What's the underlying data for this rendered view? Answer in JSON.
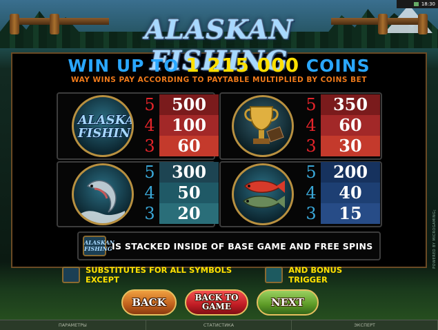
{
  "topbar": {
    "time": "18:30"
  },
  "logo": {
    "text": "ALASKAN FISHING"
  },
  "headline": {
    "prefix": "WIN UP TO",
    "amount": "1 215 000",
    "suffix": "COINS"
  },
  "subline": "WAY WINS PAY ACCORDING TO PAYTABLE MULTIPLIED BY COINS BET",
  "paytable": [
    {
      "symbol": "alaskan-fishing-logo",
      "symbol_text": "ALASKAN FISHING",
      "counts": [
        "5",
        "4",
        "3"
      ],
      "pays": [
        "500",
        "100",
        "60"
      ],
      "count_color": "#e4242a"
    },
    {
      "symbol": "trophy-cup-logbook",
      "counts": [
        "5",
        "4",
        "3"
      ],
      "pays": [
        "350",
        "60",
        "30"
      ],
      "count_color": "#e4242a"
    },
    {
      "symbol": "jumping-salmon",
      "counts": [
        "5",
        "4",
        "3"
      ],
      "pays": [
        "300",
        "50",
        "20"
      ],
      "count_color": "#3aa8d8"
    },
    {
      "symbol": "fish-pair",
      "counts": [
        "5",
        "4",
        "3"
      ],
      "pays": [
        "200",
        "40",
        "15"
      ],
      "count_color": "#3aa8d8"
    }
  ],
  "notes": {
    "stacked_icon_text": "ALASKAN FISHING",
    "stacked_text": "IS STACKED INSIDE OF BASE GAME AND FREE SPINS",
    "substitutes_text": "SUBSTITUTES FOR ALL SYMBOLS EXCEPT",
    "bonus_text": "AND BONUS TRIGGER"
  },
  "buttons": {
    "back": "BACK",
    "back_to_game": "BACK TO GAME",
    "next": "NEXT"
  },
  "statusbar": {
    "items": [
      "ПАРАМЕТРЫ",
      "СТАТИСТИКА",
      "ЭКСПЕРТ"
    ]
  },
  "side_text": "POWERED BY MICROGAMING™"
}
